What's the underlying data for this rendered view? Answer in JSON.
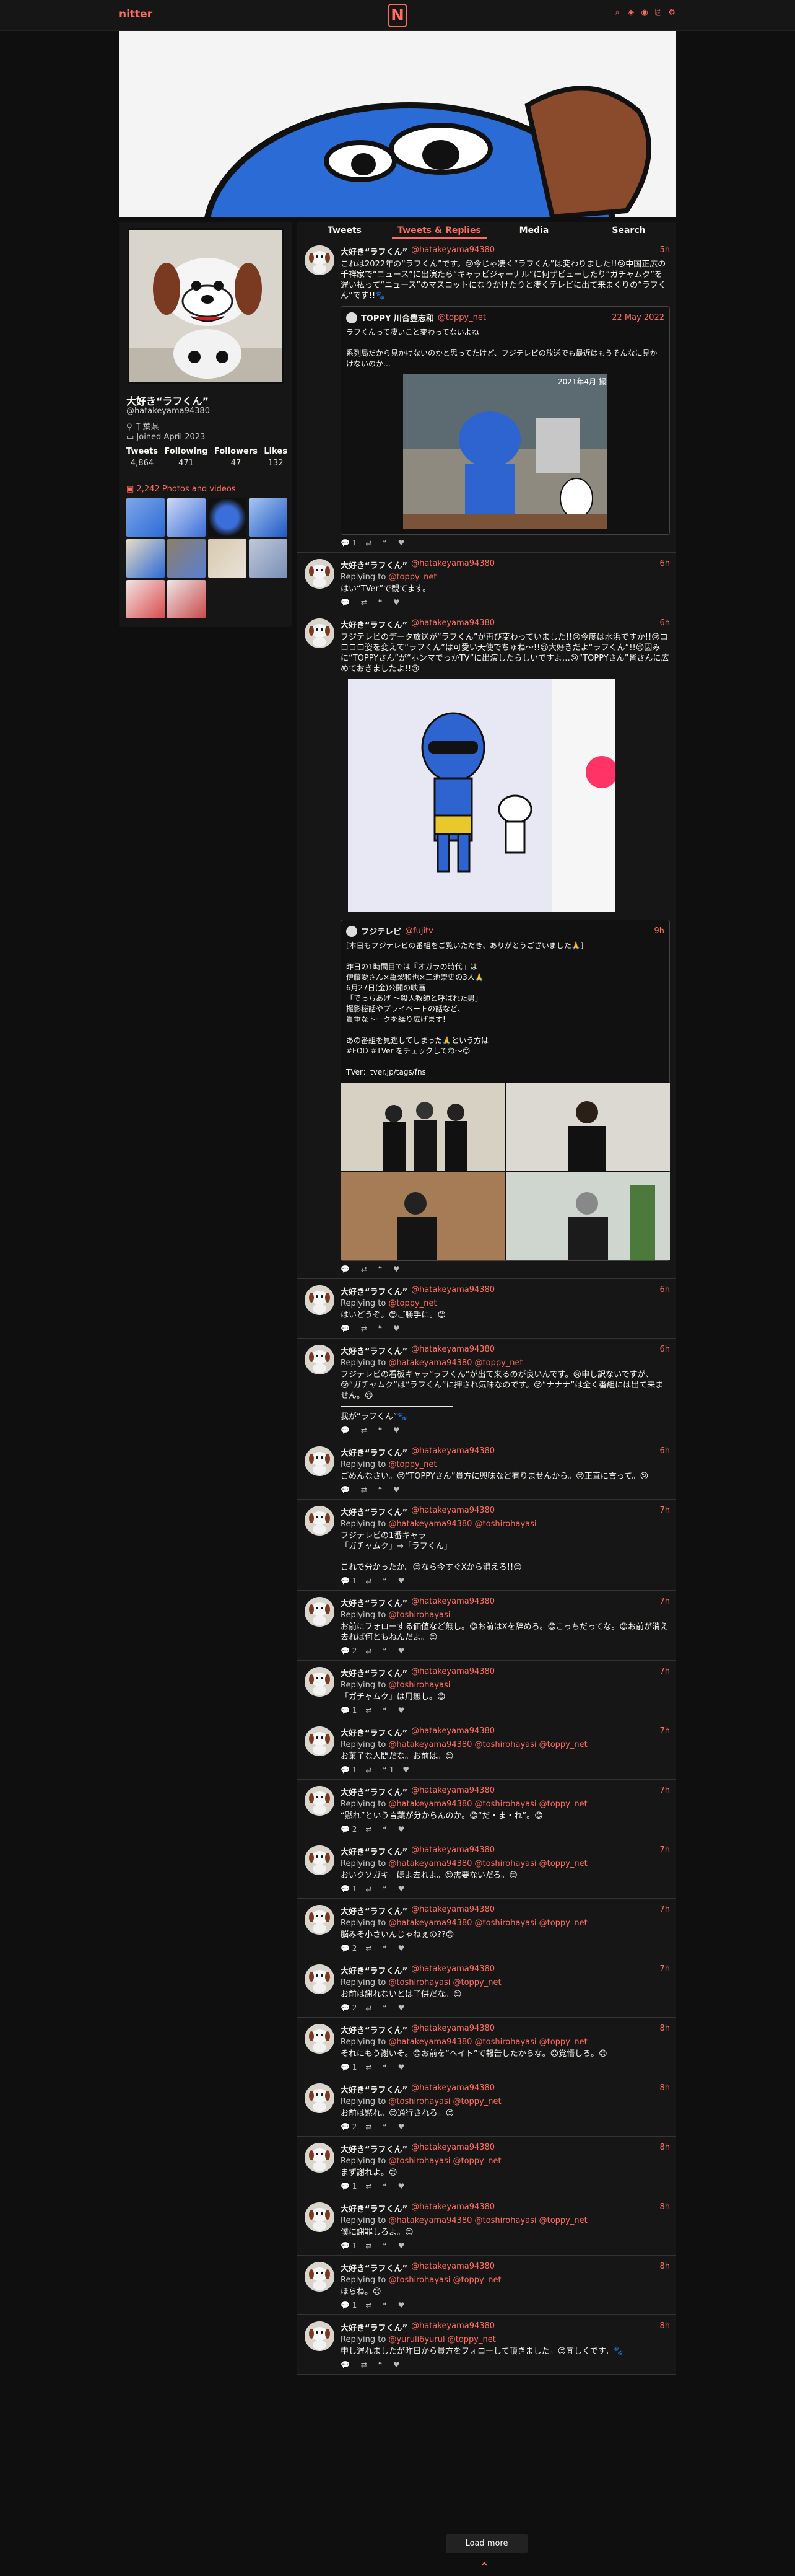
{
  "nav": {
    "brand": "nitter",
    "logo": "N",
    "icons": [
      "search-icon",
      "rss-icon",
      "rss-icon",
      "link-icon",
      "settings-icon"
    ]
  },
  "profile": {
    "name": "大好き“ラフくん”",
    "handle": "@hatakeyama94380",
    "location": "千葉県",
    "joined": "Joined April 2023",
    "stats": [
      {
        "label": "Tweets",
        "value": "4,864"
      },
      {
        "label": "Following",
        "value": "471"
      },
      {
        "label": "Followers",
        "value": "47"
      },
      {
        "label": "Likes",
        "value": "132"
      }
    ],
    "media_label": "2,242 Photos and videos"
  },
  "tabs": [
    "Tweets",
    "Tweets & Replies",
    "Media",
    "Search"
  ],
  "tweets": [
    {
      "name": "大好き“ラフくん”",
      "user": "@hatakeyama94380",
      "date": "5h",
      "reply": "",
      "body": "これは2022年の“ラフくん”です。😢今じゃ凄く“ラフくん”は変わりました!!😢中国正広の千祥家で“ニュース”に出演たら“キャラビジャーナル”に何ザビューしたり“ガチャムク”を遅い払って“ニュース”のマスコットになりかけたりと凄くテレビに出て来まくりの“ラフくん”です!!🐾",
      "stats": [
        "1",
        "",
        "",
        ""
      ],
      "quote": {
        "name": "TOPPY 川合豊志和",
        "user": "@toppy_net",
        "date": "22 May 2022",
        "body": "ラフくんって凄いこと変わってないよね\n\n系列局だから見かけないのかと思ってたけど、フジテレビの放送でも最近はもうそんなに見かけないのか…",
        "img_caption": "2021年4月 撮影"
      }
    },
    {
      "name": "大好き“ラフくん”",
      "user": "@hatakeyama94380",
      "date": "6h",
      "reply": "@toppy_net",
      "body": "はい“TVer”で観てます。",
      "stats": [
        "",
        "",
        "",
        ""
      ]
    },
    {
      "name": "大好き“ラフくん”",
      "user": "@hatakeyama94380",
      "date": "6h",
      "reply": "",
      "body": "フジテレビのデータ放送が“ラフくん”が再び変わっていました!!😢今度は水浜ですか!!😢コロコロ姿を変えて“ラフくん”は可愛い天使でちゅね〜!!😢大好きだよ“ラフくん”!!😢因みに“TOPPYさん”が“ホンマでっかTV”に出演したらしいですよ…😢“TOPPYさん”皆さんに広めておきましたよ!!😢",
      "stats": [
        "",
        "",
        "",
        ""
      ],
      "quote": {
        "name": "フジテレビ",
        "user": "@fujitv",
        "date": "9h",
        "body": "[本日もフジテレビの番組をご覧いただき、ありがとうございました🙏]\n\n昨日の1時間目では『オガラの時代』は\n伊藤愛さん×亀梨和也×三池崇史の3人🙏\n6月27日(金)公開の映画\n「でっちあげ ～殺人教師と呼ばれた男」\n撮影秘話やプライベートの話など、\n貴重なトークを繰り広げます!\n\nあの番組を見逃してしまった🙏という方は\n#FOD #TVer をチェックしてね〜😊\n\nTVer：tver.jp/tags/fns"
      }
    },
    {
      "name": "大好き“ラフくん”",
      "user": "@hatakeyama94380",
      "date": "6h",
      "reply": "@toppy_net",
      "body": "はいどうぞ。😊ご勝手に。😊",
      "stats": [
        "",
        "",
        "",
        ""
      ]
    },
    {
      "name": "大好き“ラフくん”",
      "user": "@hatakeyama94380",
      "date": "6h",
      "reply": "@hatakeyama94380 @toppy_net",
      "body": "フジテレビの看板キャラ“ラフくん”が出て来るのが良いんです。😢申し訳ないですが、😢“ガチャムク”は“ラフくん”に押され気味なのです。😢“ナナナ”は全く番組には出て来ません。😢\n――――――――――――――\n我が“ラフくん”🐾",
      "stats": [
        "",
        "",
        "",
        ""
      ]
    },
    {
      "name": "大好き“ラフくん”",
      "user": "@hatakeyama94380",
      "date": "6h",
      "reply": "@toppy_net",
      "body": "ごめんなさい。😢“TOPPYさん”貴方に興味など有りませんから。😢正直に言って。😢",
      "stats": [
        "",
        "",
        "",
        ""
      ]
    },
    {
      "name": "大好き“ラフくん”",
      "user": "@hatakeyama94380",
      "date": "7h",
      "reply": "@hatakeyama94380 @toshirohayasi",
      "body": "フジテレビの1番キャラ\n「ガチャムク」→「ラフくん」\n―――――――――――――――\nこれで分かったか。😊なら今すぐXから消えろ!!😊",
      "stats": [
        "1",
        "",
        "",
        ""
      ]
    },
    {
      "name": "大好き“ラフくん”",
      "user": "@hatakeyama94380",
      "date": "7h",
      "reply": "@toshirohayasi",
      "body": "お前にフォローする価値など無し。😊お前はXを辞めろ。😊こっちだってな。😊お前が消え去れば何ともねんだよ。😊",
      "stats": [
        "2",
        "",
        "",
        ""
      ]
    },
    {
      "name": "大好き“ラフくん”",
      "user": "@hatakeyama94380",
      "date": "7h",
      "reply": "@toshirohayasi",
      "body": "「ガチャムク」は用無し。😊",
      "stats": [
        "1",
        "",
        "",
        ""
      ]
    },
    {
      "name": "大好き“ラフくん”",
      "user": "@hatakeyama94380",
      "date": "7h",
      "reply": "@hatakeyama94380 @toshirohayasi @toppy_net",
      "body": "お菓子な人間だな。お前は。😊",
      "stats": [
        "1",
        "",
        "1",
        ""
      ]
    },
    {
      "name": "大好き“ラフくん”",
      "user": "@hatakeyama94380",
      "date": "7h",
      "reply": "@hatakeyama94380 @toshirohayasi @toppy_net",
      "body": "“黙れ”という言葉が分からんのか。😊“だ・ま・れ”。😊",
      "stats": [
        "2",
        "",
        "",
        ""
      ]
    },
    {
      "name": "大好き“ラフくん”",
      "user": "@hatakeyama94380",
      "date": "7h",
      "reply": "@hatakeyama94380 @toshirohayasi @toppy_net",
      "body": "おいクソガキ。ほよ去れよ。😊需要ないだろ。😊",
      "stats": [
        "1",
        "",
        "",
        ""
      ]
    },
    {
      "name": "大好き“ラフくん”",
      "user": "@hatakeyama94380",
      "date": "7h",
      "reply": "@hatakeyama94380 @toshirohayasi @toppy_net",
      "body": "脳みそ小さいんじゃねぇの??😊",
      "stats": [
        "2",
        "",
        "",
        ""
      ]
    },
    {
      "name": "大好き“ラフくん”",
      "user": "@hatakeyama94380",
      "date": "7h",
      "reply": "@toshirohayasi @toppy_net",
      "body": "お前は謝れないとは子供だな。😊",
      "stats": [
        "2",
        "",
        "",
        ""
      ]
    },
    {
      "name": "大好き“ラフくん”",
      "user": "@hatakeyama94380",
      "date": "8h",
      "reply": "@hatakeyama94380 @toshirohayasi @toppy_net",
      "body": "それにもう謝いそ。😊お前を“ヘイト”で報告したからな。😊覚悟しろ。😊",
      "stats": [
        "1",
        "",
        "",
        ""
      ]
    },
    {
      "name": "大好き“ラフくん”",
      "user": "@hatakeyama94380",
      "date": "8h",
      "reply": "@toshirohayasi @toppy_net",
      "body": "お前は黙れ。😊通行されろ。😊",
      "stats": [
        "2",
        "",
        "",
        ""
      ]
    },
    {
      "name": "大好き“ラフくん”",
      "user": "@hatakeyama94380",
      "date": "8h",
      "reply": "@toshirohayasi @toppy_net",
      "body": "まず謝れよ。😊",
      "stats": [
        "1",
        "",
        "",
        ""
      ]
    },
    {
      "name": "大好き“ラフくん”",
      "user": "@hatakeyama94380",
      "date": "8h",
      "reply": "@hatakeyama94380 @toshirohayasi @toppy_net",
      "body": "僕に謝罪しろよ。😊",
      "stats": [
        "1",
        "",
        "",
        ""
      ]
    },
    {
      "name": "大好き“ラフくん”",
      "user": "@hatakeyama94380",
      "date": "8h",
      "reply": "@toshirohayasi @toppy_net",
      "body": "ほらね。😊",
      "stats": [
        "1",
        "",
        "",
        ""
      ]
    },
    {
      "name": "大好き“ラフくん”",
      "user": "@hatakeyama94380",
      "date": "8h",
      "reply": "@yuruli6yurul @toppy_net",
      "body": "申し遅れましたが昨日から貴方をフォローして頂きました。😊宜しくです。🐾",
      "stats": [
        "",
        "",
        "",
        ""
      ]
    }
  ],
  "labels": {
    "replying_to": "Replying to",
    "load_more": "Load more",
    "top": "⌃"
  }
}
